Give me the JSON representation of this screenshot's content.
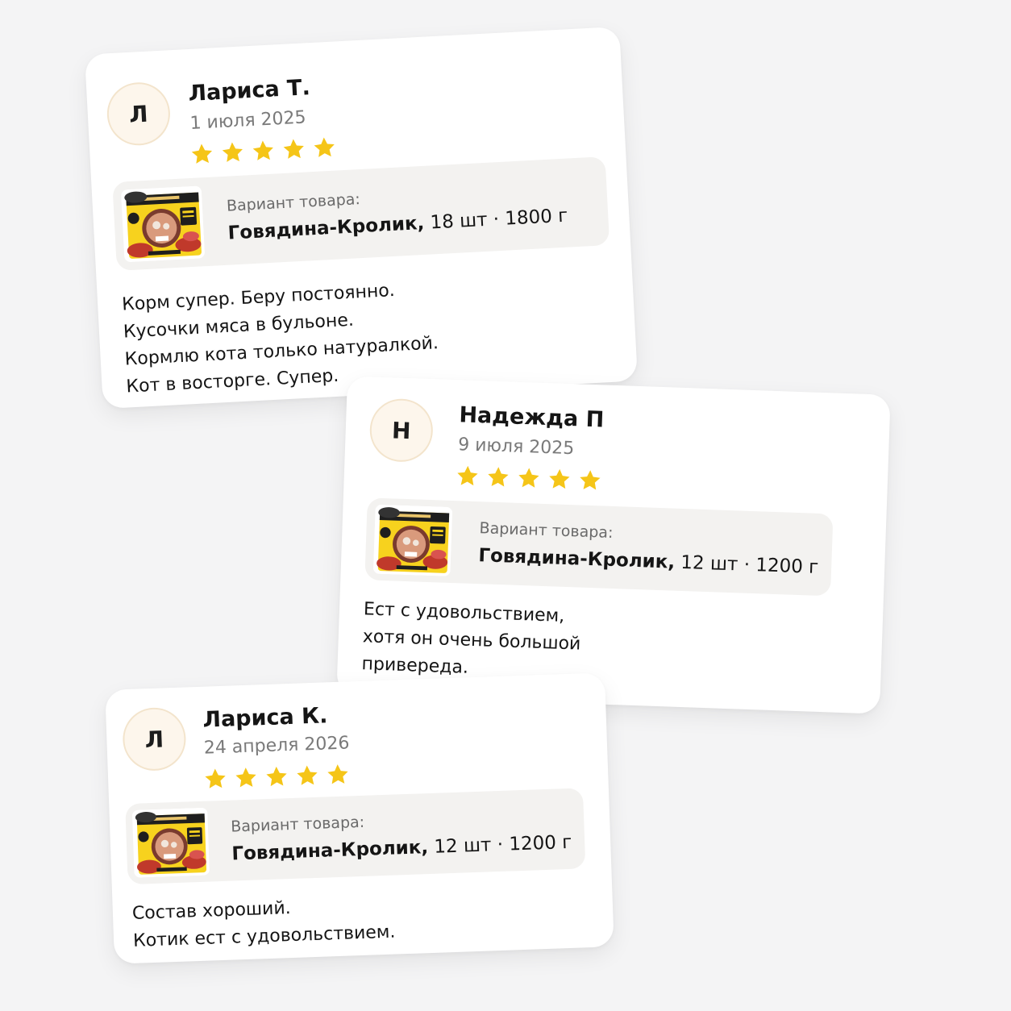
{
  "colors": {
    "star": "#f5c518",
    "avatar_bg": "#fdf6ec",
    "variant_bg": "#f3f2f0",
    "page_bg": "#f4f4f5"
  },
  "reviews": [
    {
      "avatar_letter": "Л",
      "author": "Лариса Т.",
      "date": "1 июля 2025",
      "rating": 5,
      "variant_label": "Вариант товара:",
      "variant_name": "Говядина-Кролик,",
      "variant_details": "18 шт · 1800 г",
      "text_lines": [
        "Корм супер. Беру постоянно.",
        "Кусочки мяса в бульоне.",
        "Кормлю кота только натуралкой.",
        "Кот в восторге. Супер."
      ]
    },
    {
      "avatar_letter": "Н",
      "author": "Надежда П",
      "date": "9 июля 2025",
      "rating": 5,
      "variant_label": "Вариант товара:",
      "variant_name": "Говядина-Кролик,",
      "variant_details": "12 шт · 1200 г",
      "text_lines": [
        "Ест с удовольствием,",
        "хотя он очень большой",
        "привереда."
      ]
    },
    {
      "avatar_letter": "Л",
      "author": "Лариса К.",
      "date": "24 апреля 2026",
      "rating": 5,
      "variant_label": "Вариант товара:",
      "variant_name": "Говядина-Кролик,",
      "variant_details": "12 шт · 1200 г",
      "text_lines": [
        "Состав хороший.",
        "Котик ест с удовольствием."
      ]
    }
  ]
}
